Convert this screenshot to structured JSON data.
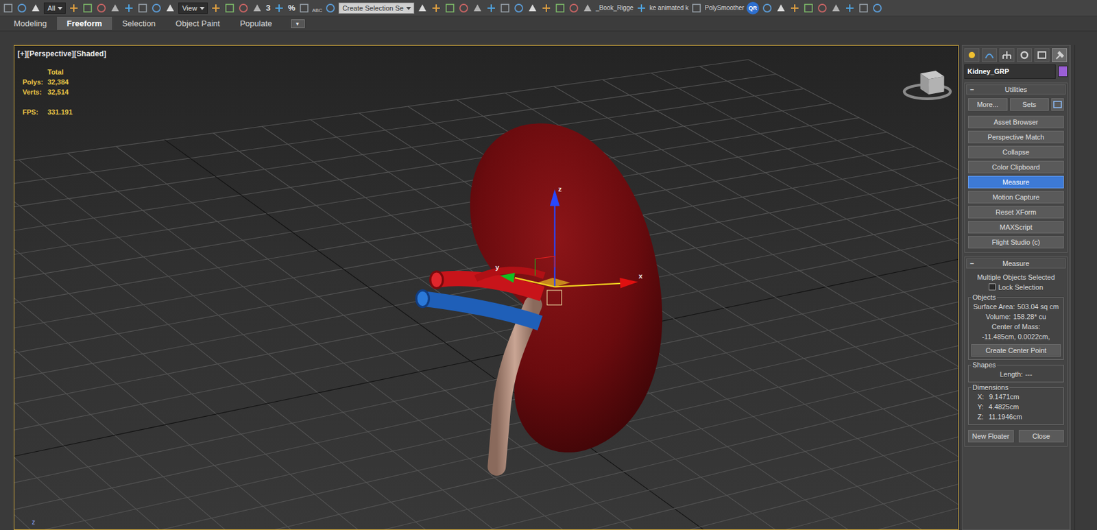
{
  "toolbar": {
    "items": [
      {
        "kind": "dropdown",
        "text": "All"
      },
      {
        "kind": "dropdown",
        "text": "View"
      },
      {
        "kind": "glyph",
        "text": "3"
      },
      {
        "kind": "glyph",
        "text": "%"
      },
      {
        "kind": "small",
        "text": "ABC"
      },
      {
        "kind": "dropdown-light",
        "text": "Create Selection Se"
      },
      {
        "kind": "text",
        "text": "_Book_Rigge"
      },
      {
        "kind": "text",
        "text": "ke animated k"
      },
      {
        "kind": "text",
        "text": "PolySmoother"
      },
      {
        "kind": "badge",
        "text": "QR"
      }
    ]
  },
  "ribbon": {
    "tabs": [
      {
        "label": "Modeling",
        "selected": false
      },
      {
        "label": "Freeform",
        "selected": true
      },
      {
        "label": "Selection",
        "selected": false
      },
      {
        "label": "Object Paint",
        "selected": false
      },
      {
        "label": "Populate",
        "selected": false
      }
    ],
    "more": "▾"
  },
  "viewport": {
    "label": "[+][Perspective][Shaded]",
    "stats": {
      "heading": "Total",
      "rows": [
        {
          "label": "Polys:",
          "value": "32,384"
        },
        {
          "label": "Verts:",
          "value": "32,514"
        }
      ],
      "fps_label": "FPS:",
      "fps_value": "331.191"
    },
    "gizmo": {
      "x": "x",
      "y": "y",
      "z": "z"
    },
    "corner_axis": "z"
  },
  "command_panel": {
    "tabs": [
      {
        "selected": false
      },
      {
        "selected": false
      },
      {
        "selected": false
      },
      {
        "selected": false
      },
      {
        "selected": false
      },
      {
        "selected": true
      }
    ],
    "object_name": "Kidney_GRP",
    "object_color": "#9b5fd6",
    "utilities": {
      "toggle": "−",
      "title": "Utilities",
      "more": "More...",
      "sets": "Sets",
      "buttons": [
        {
          "label": "Asset Browser",
          "selected": false
        },
        {
          "label": "Perspective Match",
          "selected": false
        },
        {
          "label": "Collapse",
          "selected": false
        },
        {
          "label": "Color Clipboard",
          "selected": false
        },
        {
          "label": "Measure",
          "selected": true
        },
        {
          "label": "Motion Capture",
          "selected": false
        },
        {
          "label": "Reset XForm",
          "selected": false
        },
        {
          "label": "MAXScript",
          "selected": false
        },
        {
          "label": "Flight Studio (c)",
          "selected": false
        }
      ]
    },
    "measure": {
      "toggle": "−",
      "title": "Measure",
      "status": "Multiple Objects Selected",
      "lock_selection": {
        "label": "Lock Selection",
        "checked": false
      },
      "objects": {
        "title": "Objects",
        "surface_area_label": "Surface Area:",
        "surface_area": "503.04 sq cm",
        "volume_label": "Volume:",
        "volume": "158.28* cu",
        "center_label": "Center of Mass:",
        "center": "-11.485cm, 0.0022cm,",
        "button": "Create Center Point"
      },
      "shapes": {
        "title": "Shapes",
        "length_label": "Length:",
        "length": "---"
      },
      "dimensions": {
        "title": "Dimensions",
        "rows": [
          {
            "axis": "X:",
            "value": "9.1471cm"
          },
          {
            "axis": "Y:",
            "value": "4.4825cm"
          },
          {
            "axis": "Z:",
            "value": "11.1946cm"
          }
        ]
      },
      "buttons": [
        "New Floater",
        "Close"
      ]
    }
  }
}
